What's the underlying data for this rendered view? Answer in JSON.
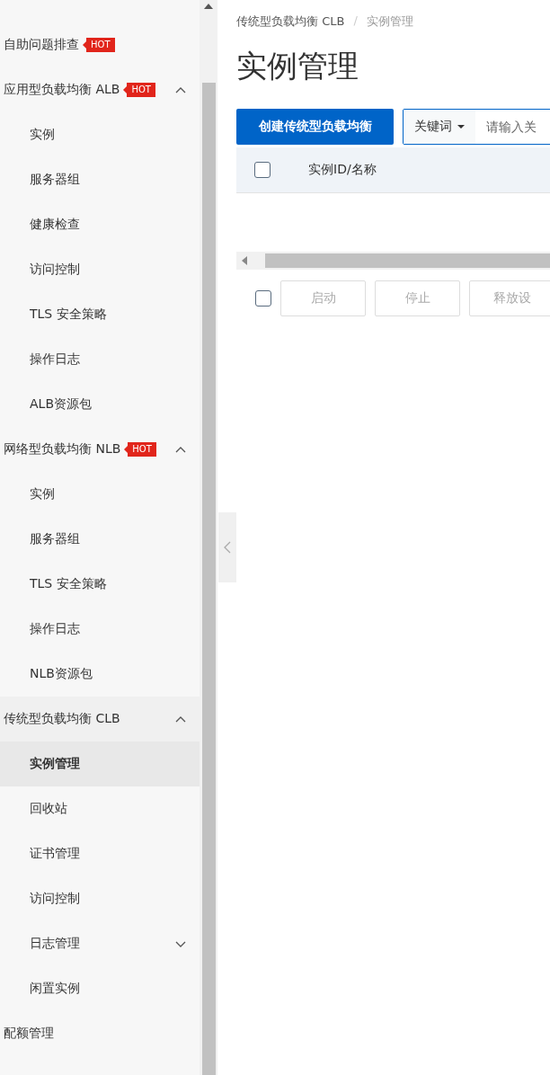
{
  "sidebar": {
    "items": [
      {
        "kind": "link",
        "label": "自助问题排查",
        "badge": "HOT",
        "selected": false
      },
      {
        "kind": "group",
        "label": "应用型负载均衡 ALB",
        "badge": "HOT",
        "expanded": true,
        "children": [
          {
            "label": "实例",
            "selected": false
          },
          {
            "label": "服务器组",
            "selected": false
          },
          {
            "label": "健康检查",
            "selected": false
          },
          {
            "label": "访问控制",
            "selected": false
          },
          {
            "label": "TLS 安全策略",
            "selected": false
          },
          {
            "label": "操作日志",
            "selected": false
          },
          {
            "label": "ALB资源包",
            "selected": false
          }
        ]
      },
      {
        "kind": "group",
        "label": "网络型负载均衡 NLB",
        "badge": "HOT",
        "expanded": true,
        "children": [
          {
            "label": "实例",
            "selected": false
          },
          {
            "label": "服务器组",
            "selected": false
          },
          {
            "label": "TLS 安全策略",
            "selected": false
          },
          {
            "label": "操作日志",
            "selected": false
          },
          {
            "label": "NLB资源包",
            "selected": false
          }
        ]
      },
      {
        "kind": "group",
        "label": "传统型负载均衡 CLB",
        "expanded": true,
        "children": [
          {
            "label": "实例管理",
            "selected": true
          },
          {
            "label": "回收站",
            "selected": false
          },
          {
            "label": "证书管理",
            "selected": false
          },
          {
            "label": "访问控制",
            "selected": false
          },
          {
            "label": "日志管理",
            "expanded": false,
            "selected": false
          },
          {
            "label": "闲置实例",
            "selected": false
          }
        ]
      },
      {
        "kind": "link",
        "label": "配额管理",
        "selected": false
      }
    ]
  },
  "breadcrumb": {
    "separator": "/",
    "items": [
      "传统型负载均衡 CLB",
      "实例管理"
    ]
  },
  "title": "实例管理",
  "toolbar": {
    "create_button": "创建传统型负载均衡",
    "search_key": "关键词",
    "search_placeholder": "请输入关"
  },
  "table": {
    "columns": [
      "实例ID/名称"
    ],
    "header_checked": false
  },
  "footer": {
    "checked": false,
    "buttons": [
      {
        "label": "启动",
        "disabled": true
      },
      {
        "label": "停止",
        "disabled": true
      },
      {
        "label": "释放设",
        "disabled": true
      }
    ]
  }
}
